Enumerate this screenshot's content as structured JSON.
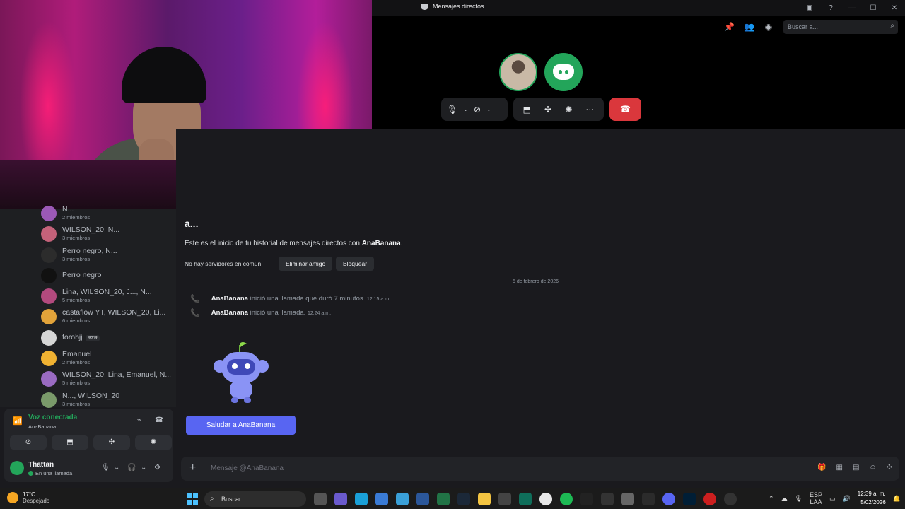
{
  "window": {
    "title": "Mensajes directos"
  },
  "call": {
    "search_placeholder": "Buscar a...",
    "hangup_color": "#da373c",
    "connected_color": "#23a55a"
  },
  "dm_list": [
    {
      "name": "N...",
      "sub": "2 miembros",
      "color": "#9b59b6"
    },
    {
      "name": "WILSON_20, N...",
      "sub": "3 miembros",
      "color": "#c4627a"
    },
    {
      "name": "Perro negro, N...",
      "sub": "3 miembros",
      "color": "#2c2c2c"
    },
    {
      "name": "Perro negro",
      "sub": "",
      "color": "#111111"
    },
    {
      "name": "Lina, WILSON_20, J..., N...",
      "sub": "5 miembros",
      "color": "#b34a7e"
    },
    {
      "name": "castaflow YT, WILSON_20, Li...",
      "sub": "6 miembros",
      "color": "#e2a33a"
    },
    {
      "name": "forobjj",
      "sub": "",
      "tag": "RZR",
      "color": "#d6d6d6"
    },
    {
      "name": "Emanuel",
      "sub": "2 miembros",
      "color": "#f0b232"
    },
    {
      "name": "WILSON_20, Lina, Emanuel, N...",
      "sub": "5 miembros",
      "color": "#9a6bc2"
    },
    {
      "name": "N..., WILSON_20",
      "sub": "3 miembros",
      "color": "#7a9a6a"
    }
  ],
  "voice": {
    "title": "Voz conectada",
    "channel": "AnaBanana"
  },
  "user": {
    "name": "Thattan",
    "status": "En una llamada"
  },
  "chat": {
    "heading": "a...",
    "intro_prefix": "Este es el inicio de tu historial de mensajes directos con ",
    "intro_name": "AnaBanana",
    "intro_suffix": ".",
    "no_servers": "No hay servidores en común",
    "remove_friend": "Eliminar amigo",
    "block": "Bloquear",
    "date_divider": "5 de febrero de 2026",
    "messages": [
      {
        "user": "AnaBanana",
        "text": "inició una llamada que duró 7 minutos.",
        "time": "12:15 a.m."
      },
      {
        "user": "AnaBanana",
        "text": "inició una llamada.",
        "time": "12:24 a.m."
      }
    ],
    "wave_button": "Saludar a AnaBanana",
    "composer_placeholder": "Mensaje @AnaBanana"
  },
  "taskbar": {
    "temperature": "17°C",
    "weather": "Despejado",
    "search": "Buscar",
    "lang_top": "ESP",
    "lang_bottom": "LAA",
    "time": "12:39 a. m.",
    "date": "5/02/2026"
  }
}
